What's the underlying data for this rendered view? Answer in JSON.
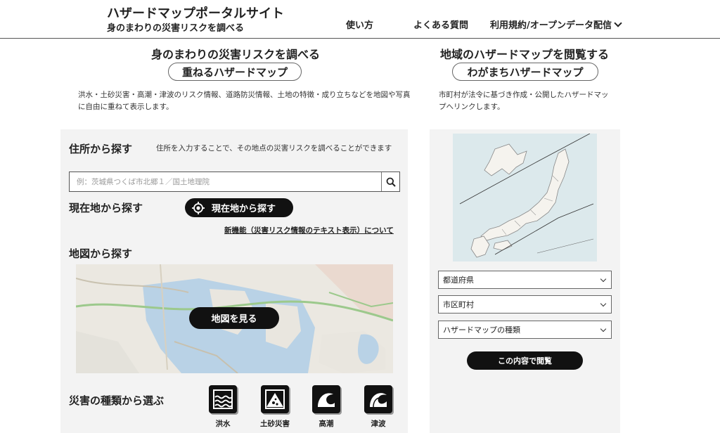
{
  "header": {
    "title": "ハザードマップポータルサイト",
    "subtitle": "身のまわりの災害リスクを調べる",
    "nav": [
      "使い方",
      "よくある質問",
      "利用規約/オープンデータ配信"
    ]
  },
  "left": {
    "lead": "身のまわりの災害リスクを調べる",
    "pill": "重ねるハザードマップ",
    "description": "洪水・土砂災害・高潮・津波のリスク情報、道路防災情報、土地の特徴・成り立ちなどを地図や写真に自由に重ねて表示します。",
    "address": {
      "heading": "住所から探す",
      "note": "住所を入力することで、その地点の災害リスクを調べることができます",
      "placeholder": "例：茨城県つくば市北郷１／国土地理院"
    },
    "location": {
      "heading": "現在地から探す",
      "button": "現在地から探す",
      "new_feature_link": "新機能（災害リスク情報のテキスト表示）について"
    },
    "map": {
      "heading": "地図から探す",
      "button": "地図を見る"
    },
    "hazard": {
      "heading": "災害の種類から選ぶ",
      "types": [
        {
          "label": "洪水",
          "icon": "flood-icon"
        },
        {
          "label": "土砂災害",
          "icon": "landslide-icon"
        },
        {
          "label": "高潮",
          "icon": "storm-surge-icon"
        },
        {
          "label": "津波",
          "icon": "tsunami-icon"
        }
      ]
    }
  },
  "right": {
    "lead": "地域のハザードマップを閲覧する",
    "pill": "わがまちハザードマップ",
    "description": "市町村が法令に基づき作成・公開したハザードマップへリンクします。",
    "selects": [
      "都道府県",
      "市区町村",
      "ハザードマップの種類"
    ],
    "button": "この内容で閲覧"
  }
}
